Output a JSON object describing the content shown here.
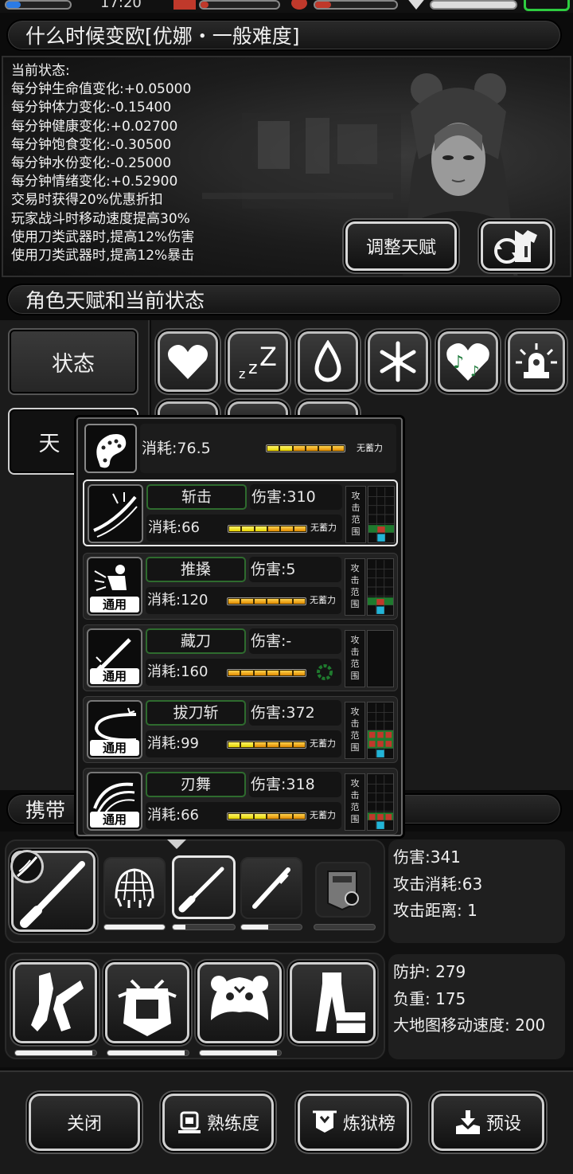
{
  "status_bar": {
    "time": "17:20"
  },
  "header": {
    "title": "什么时候变欧[优娜・一般难度]"
  },
  "info": {
    "lines": [
      "当前状态:",
      "每分钟生命值变化:+0.05000",
      "每分钟体力变化:-0.15400",
      "每分钟健康变化:+0.02700",
      "每分钟饱食变化:-0.30500",
      "每分钟水份变化:-0.25000",
      "每分钟情绪变化:+0.52900",
      "交易时获得20%优惠折扣",
      "玩家战斗时移动速度提高30%",
      "使用刀类武器时,提高12%伤害",
      "使用刀类武器时,提高12%暴击"
    ],
    "adjust_talent_label": "调整天赋"
  },
  "section2": {
    "title": "角色天赋和当前状态"
  },
  "tabs": {
    "status_label": "状态",
    "talent_label": "天"
  },
  "status_icons": [
    "heart-icon",
    "sleep-icon",
    "water-drop-icon",
    "snowflake-icon",
    "music-heart-icon",
    "alarm-icon"
  ],
  "popup": {
    "move_cost": "消耗:76.5",
    "move_no_charge": "无蓄力",
    "common_label": "通用",
    "range_label": [
      "攻",
      "击",
      "范",
      "围"
    ],
    "skills": [
      {
        "name": "斩击",
        "damage": "伤害:310",
        "cost": "消耗:66",
        "charge": "无蓄力",
        "common": false,
        "selected": true
      },
      {
        "name": "推搡",
        "damage": "伤害:5",
        "cost": "消耗:120",
        "charge": "无蓄力",
        "common": true,
        "selected": false
      },
      {
        "name": "藏刀",
        "damage": "伤害:-",
        "cost": "消耗:160",
        "charge": "",
        "common": true,
        "selected": false
      },
      {
        "name": "拔刀斩",
        "damage": "伤害:372",
        "cost": "消耗:99",
        "charge": "无蓄力",
        "common": true,
        "selected": false
      },
      {
        "name": "刃舞",
        "damage": "伤害:318",
        "cost": "消耗:66",
        "charge": "无蓄力",
        "common": true,
        "selected": false
      }
    ]
  },
  "section3": {
    "title_visible": "携带"
  },
  "weapon_stats": {
    "damage": "伤害:341",
    "attack_cost": "攻击消耗:63",
    "attack_range": "攻击距离: 1"
  },
  "armor_stats": {
    "defense": "防护: 279",
    "load": "负重: 175",
    "map_speed": "大地图移动速度: 200"
  },
  "bottom": {
    "close_label": "关闭",
    "proficiency_label": "熟练度",
    "prison_label": "炼狱榜",
    "preset_label": "预设"
  },
  "durability": {
    "knife_small": 0.15,
    "rifle": 0.45,
    "armor1": 0.95,
    "armor2": 0.95,
    "armor3": 0.95,
    "net": 1.0,
    "shield": 0.0
  }
}
